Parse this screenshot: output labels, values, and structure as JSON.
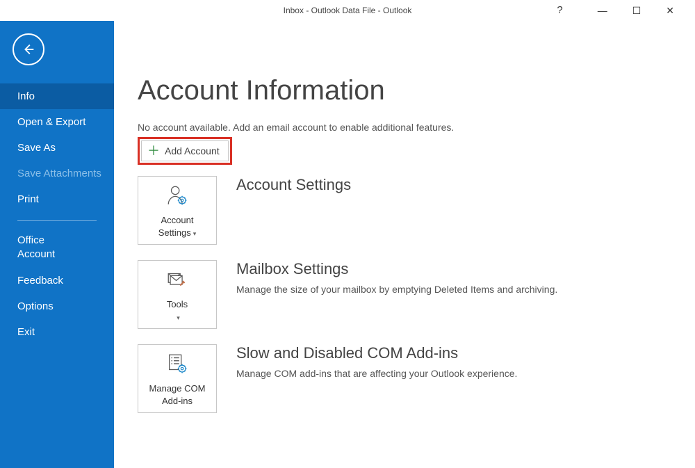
{
  "titlebar": {
    "title": "Inbox - Outlook Data File  -  Outlook"
  },
  "win": {
    "help": "?",
    "min": "—",
    "max": "☐",
    "close": "✕"
  },
  "sidebar": {
    "info": "Info",
    "open_export": "Open & Export",
    "save_as": "Save As",
    "save_attachments": "Save Attachments",
    "print": "Print",
    "office_account": "Office Account",
    "feedback": "Feedback",
    "options": "Options",
    "exit": "Exit"
  },
  "main": {
    "page_title": "Account Information",
    "no_account": "No account available. Add an email account to enable additional features.",
    "add_account_label": "Add Account",
    "sections": {
      "account": {
        "tile_label": "Account Settings",
        "heading": "Account Settings"
      },
      "mailbox": {
        "tile_label": "Tools",
        "heading": "Mailbox Settings",
        "desc": "Manage the size of your mailbox by emptying Deleted Items and archiving."
      },
      "addins": {
        "tile_label": "Manage COM Add-ins",
        "heading": "Slow and Disabled COM Add-ins",
        "desc": "Manage COM add-ins that are affecting your Outlook experience."
      }
    }
  }
}
